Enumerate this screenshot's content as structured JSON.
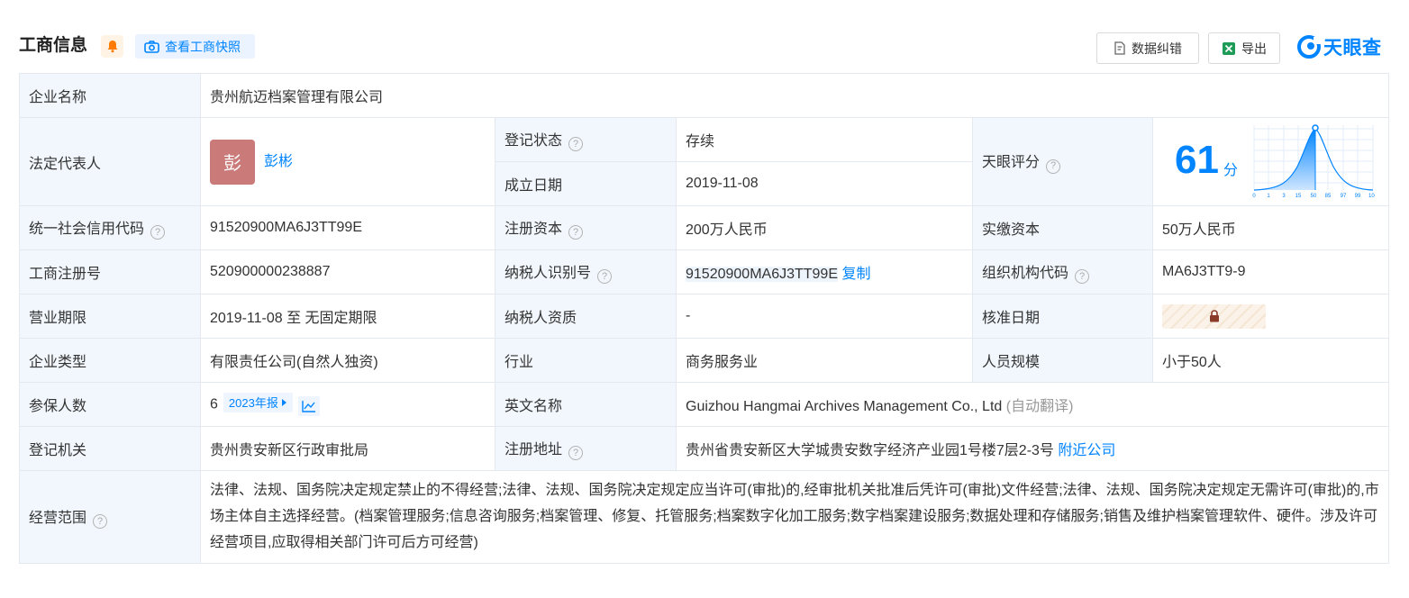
{
  "header": {
    "title": "工商信息",
    "snapshot_label": "查看工商快照",
    "correct_label": "数据纠错",
    "export_label": "导出",
    "logo_text": "天眼查"
  },
  "rows": {
    "company_name": {
      "label": "企业名称",
      "value": "贵州航迈档案管理有限公司"
    },
    "legal_rep": {
      "label": "法定代表人",
      "avatar_char": "彭",
      "name": "彭彬"
    },
    "reg_status": {
      "label": "登记状态",
      "value": "存续"
    },
    "est_date": {
      "label": "成立日期",
      "value": "2019-11-08"
    },
    "score": {
      "label": "天眼评分",
      "value": "61",
      "unit": "分",
      "ticks": [
        "0",
        "1",
        "3",
        "15",
        "50",
        "85",
        "97",
        "99",
        "100"
      ]
    },
    "credit_code": {
      "label": "统一社会信用代码",
      "value": "91520900MA6J3TT99E"
    },
    "reg_capital": {
      "label": "注册资本",
      "value": "200万人民币"
    },
    "paid_capital": {
      "label": "实缴资本",
      "value": "50万人民币"
    },
    "reg_no": {
      "label": "工商注册号",
      "value": "520900000238887"
    },
    "taxpayer_id": {
      "label": "纳税人识别号",
      "value": "91520900MA6J3TT99E",
      "copy_label": "复制"
    },
    "org_code": {
      "label": "组织机构代码",
      "value": "MA6J3TT9-9"
    },
    "term": {
      "label": "营业期限",
      "value": "2019-11-08 至 无固定期限"
    },
    "taxpayer_qual": {
      "label": "纳税人资质",
      "value": "-"
    },
    "approve_date": {
      "label": "核准日期"
    },
    "company_type": {
      "label": "企业类型",
      "value": "有限责任公司(自然人独资)"
    },
    "industry": {
      "label": "行业",
      "value": "商务服务业"
    },
    "staff_size": {
      "label": "人员规模",
      "value": "小于50人"
    },
    "insured": {
      "label": "参保人数",
      "value": "6",
      "report_label": "2023年报"
    },
    "english_name": {
      "label": "英文名称",
      "value": "Guizhou Hangmai Archives Management Co., Ltd",
      "note": "(自动翻译)"
    },
    "reg_authority": {
      "label": "登记机关",
      "value": "贵州贵安新区行政审批局"
    },
    "reg_address": {
      "label": "注册地址",
      "value": "贵州省贵安新区大学城贵安数字经济产业园1号楼7层2-3号",
      "nearby_label": "附近公司"
    },
    "scope": {
      "label": "经营范围",
      "value": "法律、法规、国务院决定规定禁止的不得经营;法律、法规、国务院决定规定应当许可(审批)的,经审批机关批准后凭许可(审批)文件经营;法律、法规、国务院决定规定无需许可(审批)的,市场主体自主选择经营。(档案管理服务;信息咨询服务;档案管理、修复、托管服务;档案数字化加工服务;数字档案建设服务;数据处理和存储服务;销售及维护档案管理软件、硬件。涉及许可经营项目,应取得相关部门许可后方可经营)"
    }
  },
  "colors": {
    "accent": "#0084ff",
    "status_green": "#009b3a",
    "label_bg": "#f2f7fd",
    "avatar_bg": "#c97a79"
  }
}
